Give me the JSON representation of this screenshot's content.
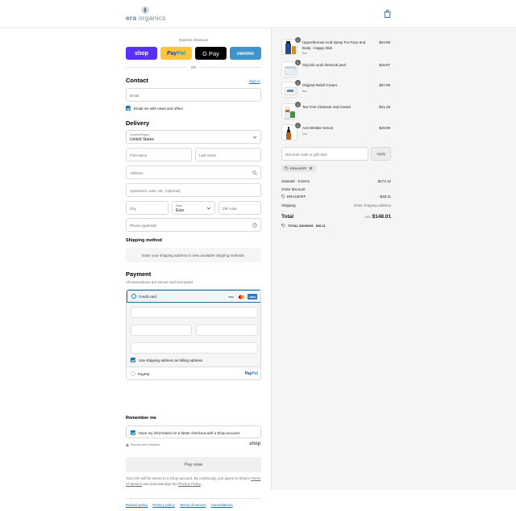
{
  "brand": {
    "name_part1": "era",
    "name_part2": " organics"
  },
  "express": {
    "title": "Express checkout",
    "or": "OR",
    "buttons": {
      "shop": "shop",
      "paypal_a": "Pay",
      "paypal_b": "Pal",
      "gpay": "G Pay",
      "venmo": "venmo"
    }
  },
  "contact": {
    "title": "Contact",
    "signin": "Sign in",
    "email_placeholder": "Email",
    "newsletter_label": "Email me with news and offers"
  },
  "delivery": {
    "title": "Delivery",
    "country_label": "Country/Region",
    "country_value": "United States",
    "first_name": "First name",
    "last_name": "Last name",
    "address": "Address",
    "apartment": "Apartment, suite, etc. (optional)",
    "city": "City",
    "state_label": "State",
    "state_value": "Ewa",
    "zip": "ZIP code",
    "phone": "Phone (optional)"
  },
  "shipping": {
    "title": "Shipping method",
    "message": "Enter your shipping address to view available shipping methods."
  },
  "payment": {
    "title": "Payment",
    "subtitle": "All transactions are secure and encrypted.",
    "credit_card": "Credit card",
    "card_logos": {
      "visa": "VISA",
      "amex": "AMEX"
    },
    "billing_same": "Use shipping address as billing address",
    "paypal": "PayPal",
    "paypal_logo_a": "Pay",
    "paypal_logo_b": "Pal"
  },
  "remember": {
    "title": "Remember me",
    "save_label": "Save my information for a faster checkout with a Shop account",
    "secure": "Secured and encrypted",
    "shop": "shop"
  },
  "paynow": "Pay now",
  "legal": {
    "pre": "Your info will be saved to a Shop account. By continuing, you agree to Shop's ",
    "terms": "Terms of Service",
    "mid": " and acknowledge the ",
    "privacy": "Privacy Policy",
    "post": "."
  },
  "footer": {
    "links": [
      "Refund policy",
      "Privacy policy",
      "Terms of service",
      "Cancellations"
    ]
  },
  "cart": {
    "items": [
      {
        "name": "Hypochlorous Acid Spray For Face and Body - Happy Skin",
        "variant": "8oz",
        "qty": "1",
        "price": "$24.99"
      },
      {
        "name": "Glycolic acid chemical peel",
        "variant": "",
        "qty": "1",
        "price": "$19.87"
      },
      {
        "name": "Original Relief Cream",
        "variant": "8oz",
        "qty": "1",
        "price": "$37.99"
      },
      {
        "name": "Tea Tree Cleanser and Cream",
        "variant": "",
        "qty": "1",
        "price": "$41.28"
      },
      {
        "name": "Anti Wrinkle Serum",
        "variant": "2oz",
        "qty": "1",
        "price": "$49.99"
      }
    ],
    "discount_placeholder": "Discount code or gift card",
    "apply": "Apply",
    "code": "ERA15OFF",
    "subtotal_label": "Subtotal · 5 items",
    "subtotal": "$174.12",
    "order_discount_label": "Order discount",
    "discount_code": "ERA15OFF",
    "discount": "- $26.11",
    "shipping_label": "Shipping",
    "shipping_value": "Enter shipping address",
    "total_label": "Total",
    "currency": "USD",
    "total": "$148.01",
    "savings_label": "TOTAL SAVINGS",
    "savings": "$26.11"
  }
}
